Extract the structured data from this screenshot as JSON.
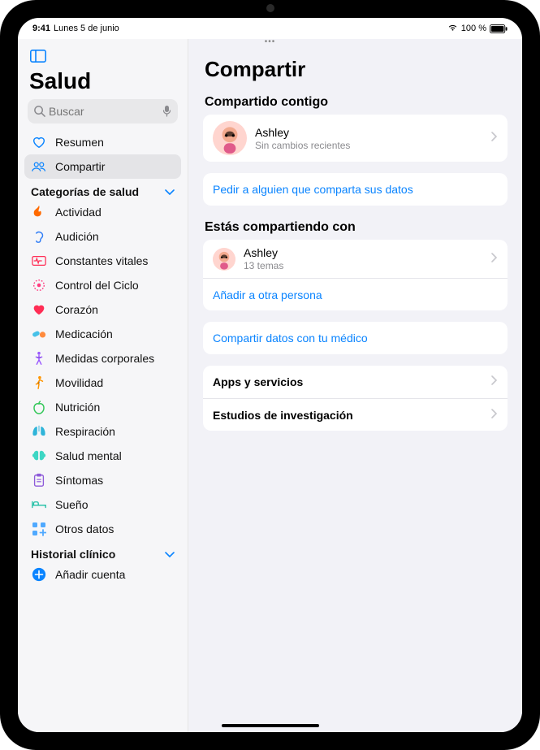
{
  "status": {
    "time": "9:41",
    "date": "Lunes 5 de junio",
    "battery_pct": "100 %"
  },
  "sidebar": {
    "app_title": "Salud",
    "search_placeholder": "Buscar",
    "summary_label": "Resumen",
    "share_label": "Compartir",
    "categories_header": "Categorías de salud",
    "items": [
      {
        "label": "Actividad"
      },
      {
        "label": "Audición"
      },
      {
        "label": "Constantes vitales"
      },
      {
        "label": "Control del Ciclo"
      },
      {
        "label": "Corazón"
      },
      {
        "label": "Medicación"
      },
      {
        "label": "Medidas corporales"
      },
      {
        "label": "Movilidad"
      },
      {
        "label": "Nutrición"
      },
      {
        "label": "Respiración"
      },
      {
        "label": "Salud mental"
      },
      {
        "label": "Síntomas"
      },
      {
        "label": "Sueño"
      },
      {
        "label": "Otros datos"
      }
    ],
    "records_header": "Historial clínico",
    "add_account_label": "Añadir cuenta"
  },
  "main": {
    "title": "Compartir",
    "shared_with_you_header": "Compartido contigo",
    "swy_contact_name": "Ashley",
    "swy_contact_status": "Sin cambios recientes",
    "ask_to_share_label": "Pedir a alguien que comparta sus datos",
    "you_share_header": "Estás compartiendo con",
    "ys_contact_name": "Ashley",
    "ys_contact_detail": "13 temas",
    "add_person_label": "Añadir a otra persona",
    "share_doctor_label": "Compartir datos con tu médico",
    "apps_label": "Apps y servicios",
    "research_label": "Estudios de investigación"
  }
}
